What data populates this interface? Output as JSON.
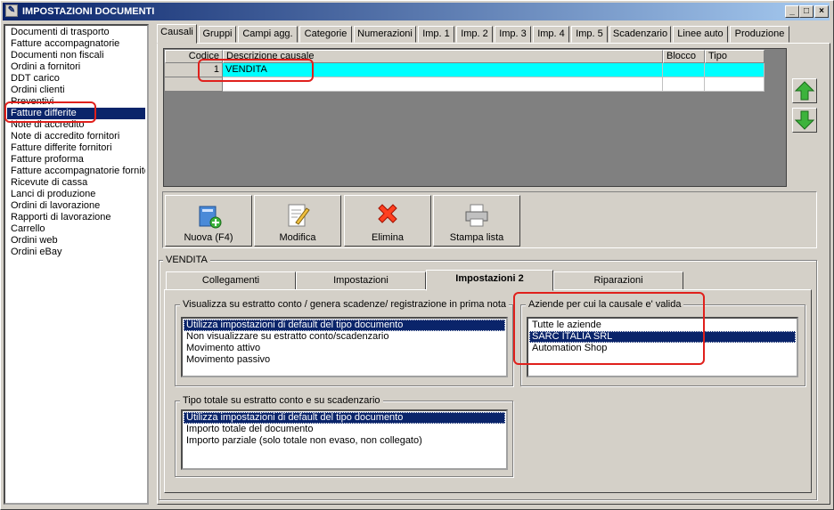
{
  "window": {
    "title": "IMPOSTAZIONI DOCUMENTI",
    "minimize": "_",
    "maximize": "□",
    "close": "×"
  },
  "doc_types": [
    {
      "label": "Documenti di trasporto"
    },
    {
      "label": "Fatture accompagnatorie"
    },
    {
      "label": "Documenti non fiscali"
    },
    {
      "label": "Ordini a fornitori"
    },
    {
      "label": "DDT carico"
    },
    {
      "label": "Ordini clienti"
    },
    {
      "label": "Preventivi"
    },
    {
      "label": "Fatture differite",
      "selected": true
    },
    {
      "label": "Note di accredito"
    },
    {
      "label": "Note di accredito fornitori"
    },
    {
      "label": "Fatture differite fornitori"
    },
    {
      "label": "Fatture proforma"
    },
    {
      "label": "Fatture accompagnatorie fornitori"
    },
    {
      "label": "Ricevute di cassa"
    },
    {
      "label": "Lanci di produzione"
    },
    {
      "label": "Ordini di lavorazione"
    },
    {
      "label": "Rapporti di lavorazione"
    },
    {
      "label": "Carrello"
    },
    {
      "label": "Ordini web"
    },
    {
      "label": "Ordini eBay"
    }
  ],
  "tabs": [
    "Causali",
    "Gruppi",
    "Campi agg.",
    "Categorie",
    "Numerazioni",
    "Imp. 1",
    "Imp. 2",
    "Imp. 3",
    "Imp. 4",
    "Imp. 5",
    "Scadenzario",
    "Linee auto",
    "Produzione"
  ],
  "grid": {
    "headers": {
      "code": "Codice",
      "description": "Descrizione causale",
      "block": "Blocco",
      "type": "Tipo"
    },
    "rows": [
      {
        "code": "1",
        "description": "VENDITA",
        "block": "",
        "type": ""
      }
    ]
  },
  "toolbar": {
    "new": "Nuova (F4)",
    "edit": "Modifica",
    "delete": "Elimina",
    "print": "Stampa lista"
  },
  "detail": {
    "group_label": "VENDITA",
    "tabs": [
      "Collegamenti",
      "Impostazioni",
      "Impostazioni 2",
      "Riparazioni"
    ],
    "statement_frame": {
      "label": "Visualizza su estratto conto / genera scadenze/ registrazione  in prima nota",
      "options": [
        "Utilizza impostazioni di default del tipo documento",
        "Non visualizzare su estratto conto/scadenzario",
        "Movimento attivo",
        "Movimento passivo"
      ]
    },
    "total_frame": {
      "label": "Tipo totale su estratto conto e su scadenzario",
      "options": [
        "Utilizza impostazioni di default del tipo documento",
        "Importo totale del documento",
        "Importo parziale (solo totale non evaso, non collegato)"
      ]
    },
    "companies_frame": {
      "label": "Aziende per cui la causale e' valida",
      "options": [
        "Tutte le aziende",
        "SARC ITALIA SRL",
        "Automation Shop"
      ]
    }
  },
  "colors": {
    "selection": "#0a246a",
    "grid_row": "#00ffff",
    "highlight": "#e0201c"
  }
}
